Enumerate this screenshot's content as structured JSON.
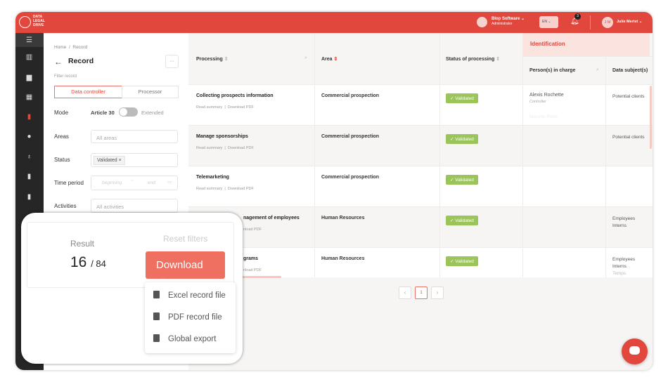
{
  "brand": {
    "name_lines": [
      "DATA",
      "LEGAL",
      "DRIVE"
    ],
    "color": "#e2473d"
  },
  "header": {
    "company": "Blop Software",
    "role": "Administrator",
    "language": "EN",
    "notifications": "3",
    "user_initials": "J M",
    "user_name": "Julie Merlet"
  },
  "sidebar": {
    "icons": [
      "menu-icon",
      "building-icon",
      "calendar-icon",
      "table-icon",
      "record-icon",
      "disc-icon",
      "stethoscope-icon",
      "document-icon",
      "document-chart-icon"
    ],
    "active": 4
  },
  "filters": {
    "breadcrumb": [
      "Home",
      "Record"
    ],
    "title": "Record",
    "more": "···",
    "subtitle": "Filter record",
    "tabs": [
      "Data controller",
      "Processor"
    ],
    "active_tab": 0,
    "mode_label": "Mode",
    "mode_left": "Article 30",
    "mode_right": "Extended",
    "areas_label": "Areas",
    "areas_placeholder": "All areas",
    "status_label": "Status",
    "status_tag": "Validated",
    "period_label": "Time period",
    "period_start": "beginning",
    "period_sep": "~",
    "period_end": "end",
    "activities_label": "Activities",
    "activities_placeholder": "All activities"
  },
  "table": {
    "group": "Identification",
    "columns": [
      "Processing",
      "Area",
      "Status of processing",
      "Person(s) in charge",
      "Data subject(s)"
    ],
    "link_read": "Read summary",
    "link_pdf": "Download PDF",
    "rows": [
      {
        "title": "Collecting prospects information",
        "links": [
          "Read summary",
          "Download PDF"
        ],
        "area": "Commercial prospection",
        "status": "Validated",
        "persons": "Alexis Rochette",
        "person_role": "Controller",
        "person2": "Maxime Rutel",
        "subjects": [
          "Potential clients"
        ]
      },
      {
        "title": "Manage sponsorships",
        "links": [
          "Read summary",
          "Download PDF"
        ],
        "area": "Commercial prospection",
        "status": "Validated",
        "subjects": [
          "Potential clients"
        ]
      },
      {
        "title": "Telemarketing",
        "links": [
          "Read summary",
          "Download PDF"
        ],
        "area": "Commercial prospection",
        "status": "Validated",
        "subjects": []
      },
      {
        "title": "nagement of employees",
        "links": [
          "nload PDF"
        ],
        "area": "Human Resources",
        "status": "Validated",
        "subjects": [
          "Employees",
          "Interns"
        ]
      },
      {
        "title": "grams",
        "links": [
          "nload PDF"
        ],
        "area": "Human Resources",
        "status": "Validated",
        "subjects": [
          "Employees",
          "Interns",
          "Temps"
        ]
      }
    ],
    "pagination": {
      "prev": "‹",
      "current": "1",
      "next": "›"
    }
  },
  "result": {
    "label": "Result",
    "count": "16",
    "total": "/ 84",
    "reset": "Reset filters",
    "download": "Download",
    "menu": [
      "Excel record file",
      "PDF record file",
      "Global export"
    ]
  }
}
